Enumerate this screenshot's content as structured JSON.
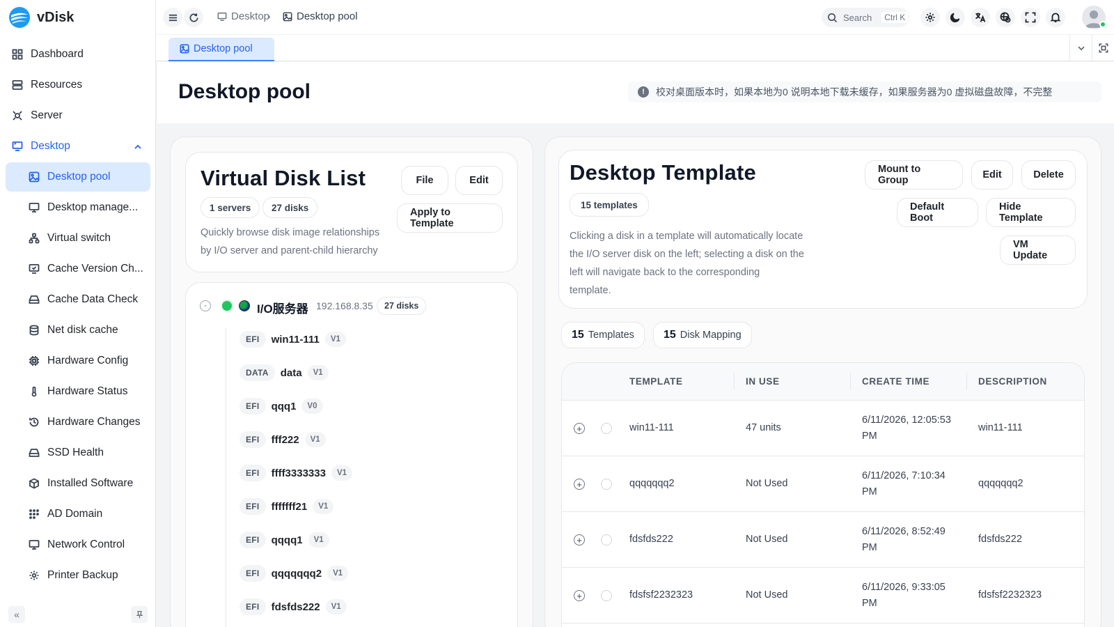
{
  "app": {
    "name": "vDisk"
  },
  "sidebar": {
    "items": [
      {
        "label": "Dashboard",
        "icon": "dashboard-icon"
      },
      {
        "label": "Resources",
        "icon": "resources-icon"
      },
      {
        "label": "Server",
        "icon": "server-icon"
      },
      {
        "label": "Desktop",
        "icon": "desktop-icon"
      },
      {
        "label": "Desktop pool",
        "icon": "image-icon"
      },
      {
        "label": "Desktop manage...",
        "icon": "monitor-icon"
      },
      {
        "label": "Virtual switch",
        "icon": "network-tree-icon"
      },
      {
        "label": "Cache Version Ch...",
        "icon": "monitor-check-icon"
      },
      {
        "label": "Cache Data Check",
        "icon": "drive-icon"
      },
      {
        "label": "Net disk cache",
        "icon": "database-icon"
      },
      {
        "label": "Hardware Config",
        "icon": "chip-icon"
      },
      {
        "label": "Hardware Status",
        "icon": "thermometer-icon"
      },
      {
        "label": "Hardware Changes",
        "icon": "history-icon"
      },
      {
        "label": "SSD Health",
        "icon": "drive-icon"
      },
      {
        "label": "Installed Software",
        "icon": "package-icon"
      },
      {
        "label": "AD Domain",
        "icon": "grid-dots-icon"
      },
      {
        "label": "Network Control",
        "icon": "monitor-icon"
      },
      {
        "label": "Printer Backup",
        "icon": "gear-icon"
      }
    ]
  },
  "topbar": {
    "breadcrumb": [
      "Desktop",
      "Desktop pool"
    ],
    "search_placeholder": "Search",
    "search_shortcut": "Ctrl K"
  },
  "tabs": [
    {
      "label": "Desktop pool"
    }
  ],
  "page": {
    "title": "Desktop pool",
    "notice": "校对桌面版本时，如果本地为0 说明本地下载未缓存，如果服务器为0 虚拟磁盘故障，不完整"
  },
  "disk_list": {
    "title": "Virtual Disk List",
    "servers_chip": "1 servers",
    "disks_chip": "27 disks",
    "buttons": {
      "file": "File",
      "edit": "Edit",
      "apply": "Apply to Template"
    },
    "description_line1": "Quickly browse disk image relationships",
    "description_line2": "by I/O server and parent-child hierarchy",
    "server": {
      "toggle": "-",
      "name": "I/O服务器",
      "ip": "192.168.8.35",
      "disks": "27 disks"
    },
    "disks": [
      {
        "type": "EFI",
        "name": "win11-111",
        "version": "V1"
      },
      {
        "type": "DATA",
        "name": "data",
        "version": "V1"
      },
      {
        "type": "EFI",
        "name": "qqq1",
        "version": "V0"
      },
      {
        "type": "EFI",
        "name": "fff222",
        "version": "V1"
      },
      {
        "type": "EFI",
        "name": "ffff3333333",
        "version": "V1"
      },
      {
        "type": "EFI",
        "name": "fffffff21",
        "version": "V1"
      },
      {
        "type": "EFI",
        "name": "qqqq1",
        "version": "V1"
      },
      {
        "type": "EFI",
        "name": "qqqqqqq2",
        "version": "V1"
      },
      {
        "type": "EFI",
        "name": "fdsfds222",
        "version": "V1"
      }
    ]
  },
  "template": {
    "title": "Desktop Template",
    "count_chip": "15 templates",
    "buttons": {
      "mount": "Mount to Group",
      "edit": "Edit",
      "delete": "Delete",
      "default_boot": "Default Boot",
      "hide": "Hide Template",
      "vm_update": "VM Update"
    },
    "description_line1": "Clicking a disk in a template will automatically locate",
    "description_line2": "the I/O server disk on the left; selecting a disk on the",
    "description_line3": "left will navigate back to the corresponding",
    "description_line4": "template.",
    "stats": [
      {
        "num": "15",
        "label": "Templates"
      },
      {
        "num": "15",
        "label": "Disk Mapping"
      }
    ],
    "columns": [
      "TEMPLATE",
      "IN USE",
      "CREATE TIME",
      "DESCRIPTION"
    ],
    "rows": [
      {
        "template": "win11-111",
        "in_use": "47 units",
        "time1": "6/11/2026, 12:05:53",
        "time2": "PM",
        "description": "win11-111"
      },
      {
        "template": "qqqqqqq2",
        "in_use": "Not Used",
        "time1": "6/11/2026, 7:10:34",
        "time2": "PM",
        "description": "qqqqqqq2"
      },
      {
        "template": "fdsfds222",
        "in_use": "Not Used",
        "time1": "6/11/2026, 8:52:49",
        "time2": "PM",
        "description": "fdsfds222"
      },
      {
        "template": "fdsfsf2232323",
        "in_use": "Not Used",
        "time1": "6/11/2026, 9:33:05",
        "time2": "PM",
        "description": "fdsfsf2232323"
      }
    ]
  },
  "colors": {
    "accent": "#2563eb",
    "accent_bg": "#dbeafe",
    "online": "#22c55e"
  }
}
